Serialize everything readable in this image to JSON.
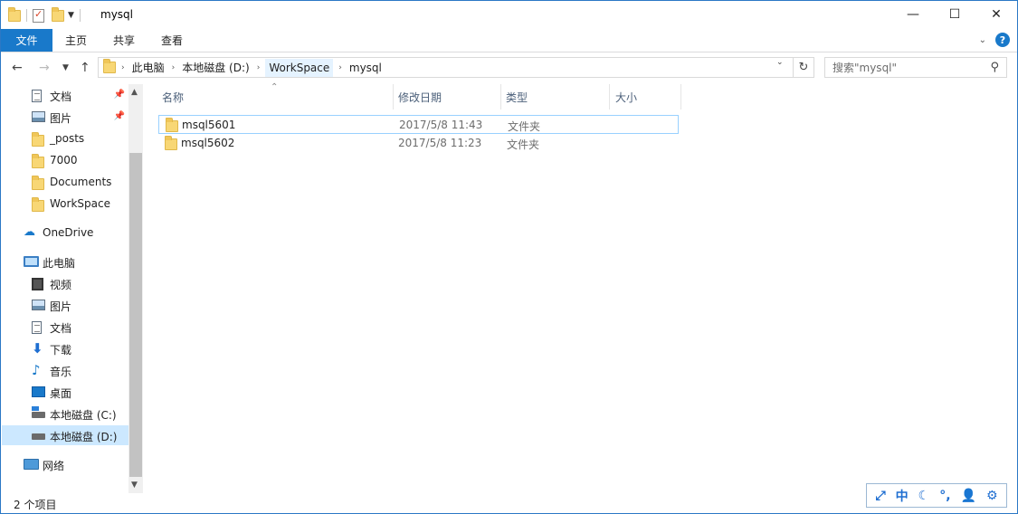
{
  "window": {
    "title": "mysql",
    "controls": {
      "minimize": "—",
      "maximize": "☐",
      "close": "✕"
    }
  },
  "ribbon": {
    "tabs": [
      "文件",
      "主页",
      "共享",
      "查看"
    ]
  },
  "address": {
    "crumbs": [
      "此电脑",
      "本地磁盘 (D:)",
      "WorkSpace",
      "mysql"
    ],
    "search_placeholder": "搜索\"mysql\""
  },
  "sidebar": {
    "quick_access": [
      {
        "label": "文档",
        "icon": "document-icon",
        "pinned": true
      },
      {
        "label": "图片",
        "icon": "picture-icon",
        "pinned": true
      },
      {
        "label": "_posts",
        "icon": "folder-icon",
        "pinned": false
      },
      {
        "label": "7000",
        "icon": "folder-icon",
        "pinned": false
      },
      {
        "label": "Documents",
        "icon": "folder-icon",
        "pinned": false
      },
      {
        "label": "WorkSpace",
        "icon": "folder-icon",
        "pinned": false
      }
    ],
    "onedrive": "OneDrive",
    "this_pc": "此电脑",
    "pc_items": [
      {
        "label": "视频",
        "icon": "video-icon"
      },
      {
        "label": "图片",
        "icon": "picture-icon"
      },
      {
        "label": "文档",
        "icon": "document-icon"
      },
      {
        "label": "下载",
        "icon": "download-icon"
      },
      {
        "label": "音乐",
        "icon": "music-icon"
      },
      {
        "label": "桌面",
        "icon": "desktop-icon"
      },
      {
        "label": "本地磁盘 (C:)",
        "icon": "drive-icon"
      },
      {
        "label": "本地磁盘 (D:)",
        "icon": "drive-icon",
        "selected": true
      }
    ],
    "network": "网络"
  },
  "columns": {
    "name": "名称",
    "modified": "修改日期",
    "type": "类型",
    "size": "大小"
  },
  "files": [
    {
      "name": "msql5601",
      "modified": "2017/5/8 11:43",
      "type": "文件夹",
      "size": ""
    },
    {
      "name": "msql5602",
      "modified": "2017/5/8 11:23",
      "type": "文件夹",
      "size": ""
    }
  ],
  "status": {
    "item_count": "2 个项目"
  },
  "ime": {
    "lang": "中"
  }
}
